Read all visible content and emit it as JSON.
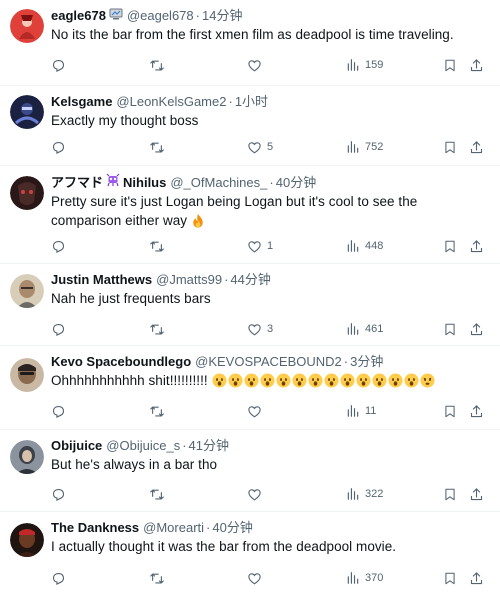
{
  "replies": [
    {
      "name": "eagle678",
      "handle": "@eagel678",
      "time": "14分钟",
      "text": "No its the bar from the first xmen film as deadpool is time traveling.",
      "likes": "",
      "views": "159",
      "avatar_color": "#e0403a"
    },
    {
      "name": "Kelsgame",
      "handle": "@LeonKelsGame2",
      "time": "1小时",
      "text": "Exactly my thought boss",
      "likes": "5",
      "views": "752",
      "avatar_color": "#1b2140"
    },
    {
      "name": "アフマド",
      "name2": "Nihilus",
      "handle": "@_OfMachines_",
      "time": "40分钟",
      "text": "Pretty sure it's just Logan being Logan but it's cool to see the comparison either way",
      "likes": "1",
      "views": "448",
      "avatar_color": "#2a1818"
    },
    {
      "name": "Justin Matthews",
      "handle": "@Jmatts99",
      "time": "44分钟",
      "text": "Nah he just frequents bars",
      "likes": "3",
      "views": "461",
      "avatar_color": "#b9a48a"
    },
    {
      "name": "Kevo Spaceboundlego",
      "handle": "@KEVOSPACEBOUND2",
      "time": "3分钟",
      "text": "Ohhhhhhhhhhh shit!!!!!!!!!!",
      "likes": "",
      "views": "11",
      "avatar_color": "#8a6a4e"
    },
    {
      "name": "Obijuice",
      "handle": "@Obijuice_s",
      "time": "41分钟",
      "text": "But he's always in a bar tho",
      "likes": "",
      "views": "322",
      "avatar_color": "#5c6470"
    },
    {
      "name": "The Dankness",
      "handle": "@Morearti",
      "time": "40分钟",
      "text": "I actually thought it was the bar from the deadpool movie.",
      "likes": "",
      "views": "370",
      "avatar_color": "#3a1e16"
    }
  ],
  "icons": {
    "reply": "reply-icon",
    "retweet": "retweet-icon",
    "like": "heart-icon",
    "views": "views-icon",
    "bookmark": "bookmark-icon",
    "share": "share-icon",
    "emoji_reaction": "astonished-face-emoji",
    "emoji_fire": "fire-emoji",
    "emoji_worried": "hushed-face-emoji",
    "badge_mac": "computer-badge-icon",
    "badge_alien": "alien-badge-icon"
  },
  "colors": {
    "text_primary": "#0f1419",
    "text_secondary": "#536471",
    "divider": "#eff3f4"
  }
}
